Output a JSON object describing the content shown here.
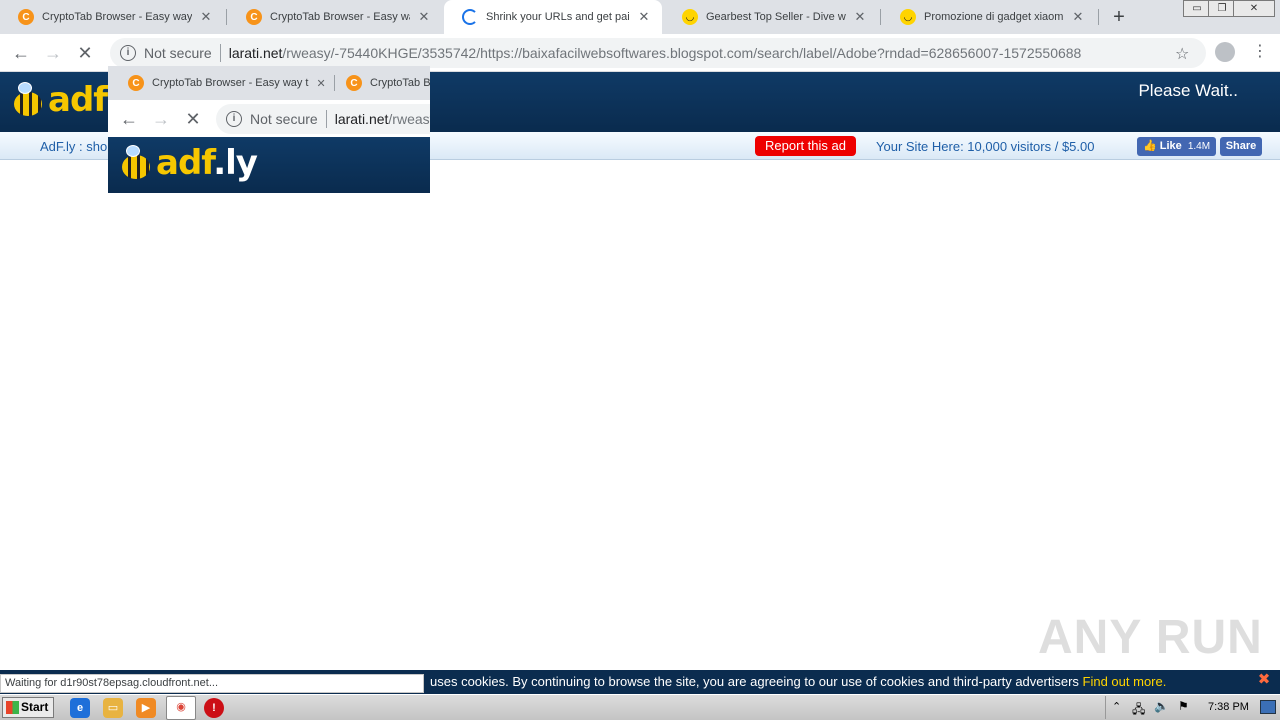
{
  "browser": {
    "tabs": [
      {
        "label": "CryptoTab Browser - Easy way t",
        "icon": "cryptotab-icon"
      },
      {
        "label": "CryptoTab Browser - Easy way t",
        "icon": "cryptotab-icon"
      },
      {
        "label": "Shrink your URLs and get paid!",
        "icon": "loading-spinner-icon"
      },
      {
        "label": "Gearbest Top Seller - Dive with t",
        "icon": "gearbest-icon"
      },
      {
        "label": "Promozione di gadget xiaomi fino",
        "icon": "gearbest-icon"
      }
    ],
    "new_tab": "+",
    "window_controls": {
      "minimize": "▭",
      "restore": "❐",
      "close": "✕"
    },
    "omnibox": {
      "security": "Not secure",
      "host": "larati.net",
      "path": "/rweasy/-75440KHGE/3535742/https://baixafacilwebsoftwares.blogspot.com/search/label/Adobe?rndad=628656007-1572550688"
    }
  },
  "page": {
    "logo": {
      "ad": "ad",
      "f": "f",
      "ly": ".ly"
    },
    "please_wait": "Please Wait..",
    "subbar": {
      "link": "AdF.ly : sho",
      "report": "Report this ad",
      "your_site": "Your Site Here: 10,000 visitors / $5.00",
      "like": "Like",
      "like_count": "1.4M",
      "share": "Share"
    }
  },
  "inset": {
    "tabs": [
      {
        "label": "CryptoTab Browser - Easy way t"
      },
      {
        "label": "CryptoTab B"
      }
    ],
    "security": "Not secure",
    "host": "larati.net",
    "path": "/rweasy"
  },
  "cookie_bar": {
    "text": " uses cookies. By continuing to browse the site, you are agreeing to our use of cookies and third-party advertisers ",
    "find_out": "Find out more."
  },
  "status_text": "Waiting for d1r90st78epsag.cloudfront.net...",
  "watermark": "ANY RUN",
  "taskbar": {
    "start": "Start",
    "clock": "7:38 PM"
  }
}
